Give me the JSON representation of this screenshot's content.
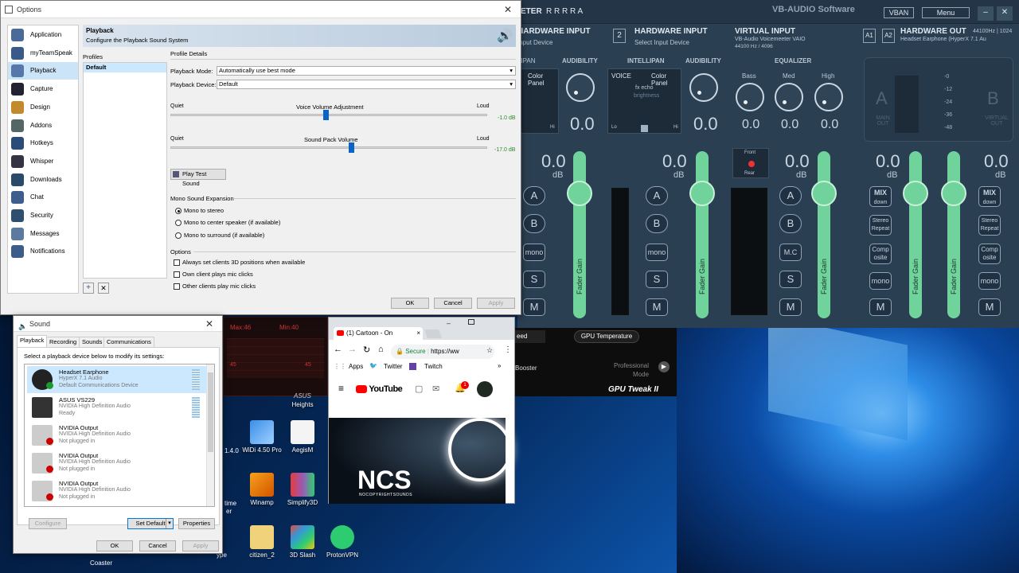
{
  "options": {
    "title": "Options",
    "sidebar": [
      "Application",
      "myTeamSpeak",
      "Playback",
      "Capture",
      "Design",
      "Addons",
      "Hotkeys",
      "Whisper",
      "Downloads",
      "Chat",
      "Security",
      "Messages",
      "Notifications"
    ],
    "selected": "Playback",
    "header_title": "Playback",
    "header_sub": "Configure the Playback Sound System",
    "profiles_label": "Profiles",
    "profile_default": "Default",
    "profile_details": "Profile Details",
    "mode_label": "Playback Mode:",
    "mode_value": "Automatically use best mode",
    "device_label": "Playback Device:",
    "device_value": "Default",
    "quiet": "Quiet",
    "loud": "Loud",
    "voice_label": "Voice Volume Adjustment",
    "voice_value": "-1.0 dB",
    "voice_pct": 0.49,
    "pack_label": "Sound Pack Volume",
    "pack_value": "-17.0 dB",
    "pack_pct": 0.57,
    "play_test": "Play Test Sound",
    "mono_section": "Mono Sound Expansion",
    "mono_opts": [
      "Mono to stereo",
      "Mono to center speaker (if available)",
      "Mono to surround (if available)"
    ],
    "options_section": "Options",
    "checks": [
      "Always set clients 3D positions when available",
      "Own client plays mic clicks",
      "Other clients play mic clicks"
    ],
    "ok": "OK",
    "cancel": "Cancel",
    "apply": "Apply"
  },
  "sound": {
    "title": "Sound",
    "tabs": [
      "Playback",
      "Recording",
      "Sounds",
      "Communications"
    ],
    "instruction": "Select a playback device below to modify its settings:",
    "devices": [
      {
        "name": "Headset Earphone",
        "desc": "HyperX 7.1 Audio",
        "status": "Default Communications Device"
      },
      {
        "name": "ASUS VS229",
        "desc": "NVIDIA High Definition Audio",
        "status": "Ready"
      },
      {
        "name": "NVIDIA Output",
        "desc": "NVIDIA High Definition Audio",
        "status": "Not plugged in"
      },
      {
        "name": "NVIDIA Output",
        "desc": "NVIDIA High Definition Audio",
        "status": "Not plugged in"
      },
      {
        "name": "NVIDIA Output",
        "desc": "NVIDIA High Definition Audio",
        "status": "Not plugged in"
      }
    ],
    "configure": "Configure",
    "set_default": "Set Default",
    "properties": "Properties",
    "ok": "OK",
    "cancel": "Cancel",
    "apply": "Apply"
  },
  "vm": {
    "title_frag": "ETER",
    "brand": "VB-AUDIO Software",
    "vban": "VBAN",
    "menu": "Menu",
    "hw_input_1": "HARDWARE INPUT",
    "hw_input_1_sub": "Input Device",
    "hw_input_2_num": "2",
    "hw_input_2": "HARDWARE INPUT",
    "hw_input_2_sub": "Select Input Device",
    "virt_input": "VIRTUAL INPUT",
    "virt_input_sub": "VB-Audio Voicemeeter VAIO",
    "virt_input_rate": "44100 Hz / 4096",
    "hw_out": "HARDWARE OUT",
    "hw_out_rate": "44100Hz | 1024",
    "hw_out_dev": "Headset Earphone (HyperX 7.1 Au",
    "a1": "A1",
    "a2": "A2",
    "intellipan": "INTELLIPAN",
    "audibility": "AUDIBILITY",
    "equalizer": "EQUALIZER",
    "color_panel": "Color Panel",
    "voice": "VOICE",
    "fx_echo": "fx echo",
    "brightness": "brightness",
    "lo": "Lo",
    "hi": "Hi",
    "bass": "Bass",
    "med": "Med",
    "high": "High",
    "db": "dB",
    "val00": "0.0",
    "fader_gain": "Fader Gain",
    "mono": "mono",
    "mc": "M.C",
    "mix_down": "MIX",
    "down": "down",
    "stereo_repeat": "Stereo Repeat",
    "composite": "Comp osite",
    "main_out": "MAIN OUT",
    "virtual_out": "VIRTUAL OUT",
    "meter_ticks": [
      "-0",
      "-12",
      "-24",
      "-36",
      "-48"
    ],
    "front": "Front",
    "rear": "Rear",
    "big_a": "A",
    "big_b": "B",
    "ctrl_a": "A",
    "ctrl_b": "B",
    "s": "S",
    "m": "M",
    "rrrr": "R R R R A"
  },
  "chrome": {
    "tab": "(1) Cartoon - On",
    "secure": "Secure",
    "url": "https://ww",
    "apps": "Apps",
    "twitter": "Twitter",
    "twitch": "Twitch",
    "yt": "YouTube",
    "notif": "1",
    "ncs": "NCS",
    "ncs_sub": "NOCOPYRIGHTSOUNDS"
  },
  "gpu": {
    "max": "Max:46",
    "min": "Min:40",
    "v45": "45",
    "v45b": "45",
    "gpu_temp": "GPU Temperature",
    "speed_frag": "eed",
    "booster": "Booster",
    "professional": "Professional",
    "mode": "Mode",
    "brand": "GPU Tweak II",
    "asus": "ASUS"
  },
  "desktop": {
    "icons": [
      {
        "label": "Heights"
      },
      {
        "label": "WiDi 4.50 Pro"
      },
      {
        "label": "AegisM"
      },
      {
        "label": "Winamp"
      },
      {
        "label": "Simplify3D"
      },
      {
        "label": "citizen_2"
      },
      {
        "label": "3D Slash"
      },
      {
        "label": "ProtonVPN"
      }
    ],
    "frag_14": "1.4.0",
    "frag_time": "time",
    "frag_er": "er",
    "frag_ype": "ype",
    "frag_coaster": "Coaster"
  }
}
